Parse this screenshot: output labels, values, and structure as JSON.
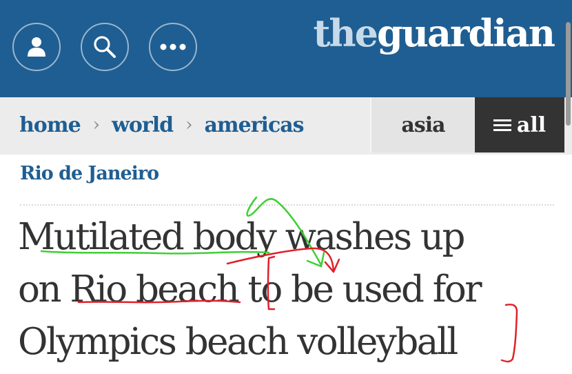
{
  "header": {
    "logo_part1": "the",
    "logo_part2": "guardian",
    "background_color": "#1f5e92",
    "icons": [
      "profile-icon",
      "search-icon",
      "more-icon"
    ]
  },
  "nav": {
    "breadcrumbs": [
      "home",
      "world",
      "americas"
    ],
    "separator": "›",
    "asia": "asia",
    "all": "all",
    "menu_icon": "hamburger-icon"
  },
  "article": {
    "kicker": "Rio de Janeiro",
    "headline_lines": [
      "Mutilated body washes up",
      "on Rio beach to be used for",
      "Olympics beach volleyball"
    ]
  },
  "annotations": {
    "green_color": "#3ecf34",
    "red_color": "#e0202a"
  }
}
